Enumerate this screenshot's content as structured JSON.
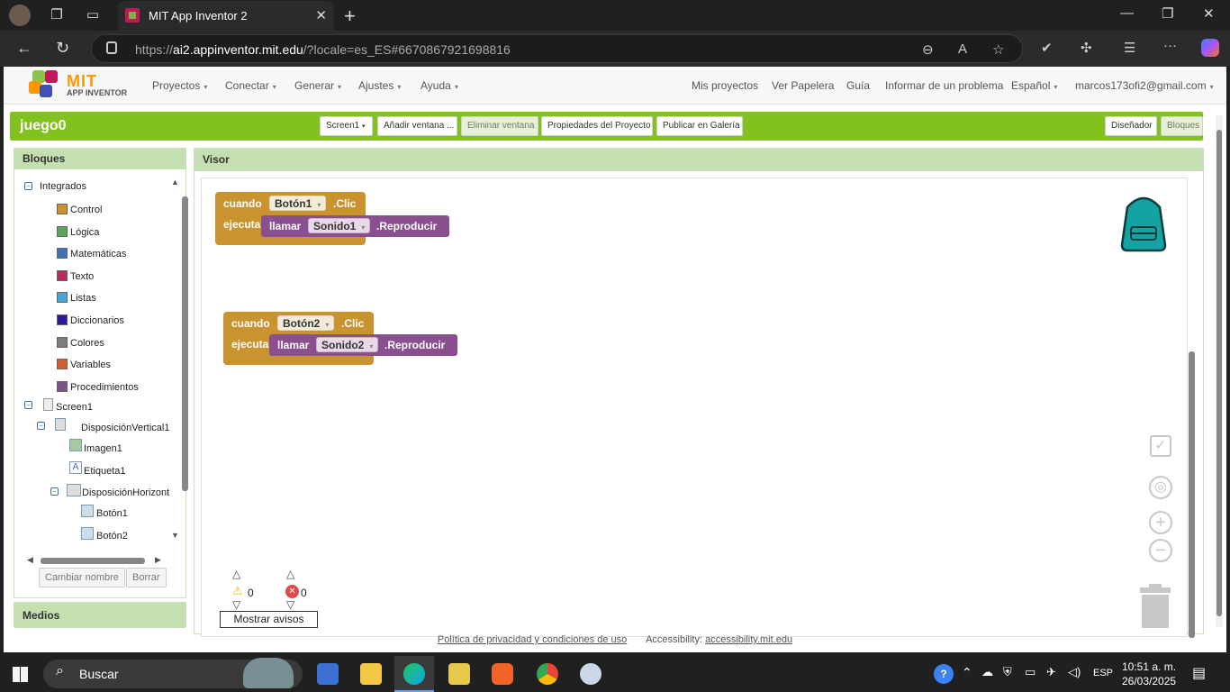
{
  "browser": {
    "tab_title": "MIT App Inventor 2",
    "url_prefix": "https://",
    "url_host": "ai2.appinventor.mit.edu",
    "url_rest": "/?locale=es_ES#6670867921698816"
  },
  "topnav": {
    "logo_title": "MIT",
    "logo_sub": "APP INVENTOR",
    "menus": [
      "Proyectos",
      "Conectar",
      "Generar",
      "Ajustes",
      "Ayuda"
    ],
    "links": [
      "Mis proyectos",
      "Ver Papelera",
      "Guía",
      "Informar de un problema"
    ],
    "language": "Español",
    "user": "marcos173ofi2@gmail.com"
  },
  "project": {
    "name": "juego0",
    "screen": "Screen1",
    "add_screen": "Añadir ventana ...",
    "remove_screen": "Eliminar ventana",
    "properties": "Propiedades del Proyecto",
    "publish": "Publicar en Galería",
    "designer": "Diseñador",
    "blocks": "Bloques"
  },
  "left": {
    "header": "Bloques",
    "builtin": "Integrados",
    "categories": [
      {
        "label": "Control",
        "color": "#c9932f"
      },
      {
        "label": "Lógica",
        "color": "#5ba55b"
      },
      {
        "label": "Matemáticas",
        "color": "#3f71b5"
      },
      {
        "label": "Texto",
        "color": "#b32d5e"
      },
      {
        "label": "Listas",
        "color": "#49a6d4"
      },
      {
        "label": "Diccionarios",
        "color": "#2d1799"
      },
      {
        "label": "Colores",
        "color": "#7d7d7d"
      },
      {
        "label": "Variables",
        "color": "#d05f2d"
      },
      {
        "label": "Procedimientos",
        "color": "#7c5385"
      }
    ],
    "components": {
      "screen": "Screen1",
      "vertical": "DisposiciónVertical1",
      "image": "Imagen1",
      "label": "Etiqueta1",
      "horizontal": "DisposiciónHorizont",
      "button1": "Botón1",
      "button2": "Botón2"
    },
    "rename": "Cambiar nombre",
    "delete": "Borrar",
    "media": "Medios"
  },
  "viewer": {
    "header": "Visor",
    "block1": {
      "when": "cuando",
      "component": "Botón1",
      "event": ".Clic",
      "do": "ejecutar",
      "call": "llamar",
      "target": "Sonido1",
      "method": ".Reproducir"
    },
    "block2": {
      "when": "cuando",
      "component": "Botón2",
      "event": ".Clic",
      "do": "ejecutar",
      "call": "llamar",
      "target": "Sonido2",
      "method": ".Reproducir"
    },
    "warnings": "0",
    "errors": "0",
    "show_warnings": "Mostrar avisos"
  },
  "footer": {
    "privacy": "Política de privacidad y condiciones de uso",
    "accessibility_label": "Accessibility:",
    "accessibility_link": "accessibility.mit.edu"
  },
  "taskbar": {
    "search": "Buscar",
    "lang": "ESP",
    "time": "10:51 a. m.",
    "date": "26/03/2025"
  }
}
